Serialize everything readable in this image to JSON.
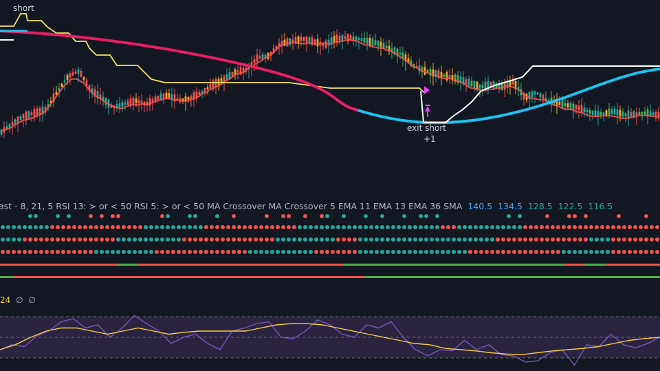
{
  "labels": {
    "signal_short": "short",
    "exit_short": "exit short",
    "exit_count": "+1"
  },
  "indicator_legend": {
    "text": "ast - 8, 21, 5 RSI 13: > or < 50 RSI 5: > or < 50 MA Crossover MA Crossover 5 EMA 11 EMA 13 EMA 36 SMA",
    "values": [
      "140.5",
      "134.5",
      "128.5",
      "122.5",
      "116.5"
    ],
    "value_colors": [
      "#42a5f5",
      "#42a5f5",
      "#26a69a",
      "#26a69a",
      "#26a69a"
    ]
  },
  "oscillator_legend": {
    "value": "24",
    "na1": "∅",
    "na2": "∅",
    "value_color": "#f5d142",
    "na_color": "#b2b5be"
  },
  "colors": {
    "background": "#131722",
    "bull": "#26a69a",
    "bull_bright": "#4caf50",
    "bear": "#ef5350",
    "neutral": "#f5a623",
    "trail_stop": "#f5e663",
    "slow_ma_bear": "#e91e63",
    "slow_ma_bull": "#1ec0f0",
    "white_stop": "#ffffff",
    "osc_line": "#7e57c2",
    "osc_signal": "#f5d142",
    "osc_band": "#2a2440",
    "exit_marker": "#e040fb"
  },
  "chart_data": [
    {
      "type": "candlestick",
      "title": "",
      "series": [
        {
          "name": "",
          "type": "ohlc",
          "kind": "price",
          "ohlc_close_path": [
            36,
            52,
            66,
            72,
            78,
            110,
            140,
            150,
            115,
            100,
            82,
            88,
            95,
            88,
            100,
            105,
            95,
            100,
            110,
            125,
            135,
            148,
            152,
            175,
            178,
            200,
            205,
            210,
            205,
            198,
            210,
            212,
            210,
            205,
            200,
            190,
            180,
            160,
            150,
            145,
            140,
            135,
            128,
            120,
            125,
            120,
            130,
            100,
            110,
            95,
            90,
            85,
            80,
            72,
            70,
            75,
            68,
            70,
            72,
            68
          ]
        },
        {
          "name": "",
          "type": "line",
          "kind": "trail_stop"
        },
        {
          "name": "",
          "type": "line",
          "kind": "slow_ma"
        },
        {
          "name": "",
          "type": "line",
          "kind": "white_stop"
        }
      ],
      "signals": [
        {
          "label": "short",
          "position": "top-left"
        },
        {
          "label": "exit short",
          "count": "+1",
          "position": "center-right"
        }
      ]
    },
    {
      "type": "dot-matrix",
      "rows": [
        "RSI 13: > or < 50",
        "RSI 5: > or < 50",
        "MA Crossover",
        "MA Crossover",
        "5 EMA 11 EMA 13 EMA 36 SMA"
      ],
      "row_values": [
        "140.5",
        "134.5",
        "128.5",
        "122.5",
        "116.5"
      ]
    },
    {
      "type": "line",
      "series": [
        {
          "name": "",
          "kind": "oscillator",
          "values": [
            470,
            478,
            475,
            492,
            500,
            515,
            520,
            505,
            510,
            490,
            505,
            525,
            512,
            500,
            480,
            490,
            495,
            480,
            470,
            500,
            505,
            512,
            515,
            490,
            488,
            500,
            518,
            510,
            495,
            490,
            510,
            505,
            515,
            490,
            470,
            460,
            470,
            468,
            485,
            470,
            478,
            462,
            460,
            450,
            452,
            465,
            470,
            445,
            478,
            475,
            495,
            478,
            473,
            480,
            490
          ]
        },
        {
          "name": "",
          "kind": "signal",
          "values": [
            470,
            478,
            490,
            500,
            505,
            505,
            500,
            495,
            500,
            505,
            500,
            495,
            498,
            500,
            500,
            500,
            500,
            505,
            510,
            512,
            512,
            510,
            505,
            500,
            495,
            490,
            485,
            480,
            478,
            472,
            470,
            468,
            465,
            463,
            462,
            465,
            468,
            470,
            472,
            475,
            480,
            485,
            488,
            490
          ]
        }
      ]
    }
  ]
}
